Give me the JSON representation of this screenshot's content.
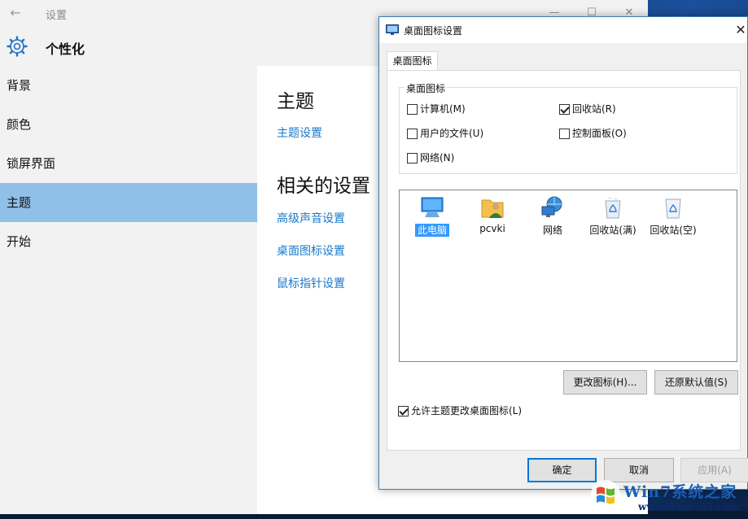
{
  "settings": {
    "window_title": "设置",
    "section_title": "个性化",
    "nav_items": [
      {
        "label": "背景"
      },
      {
        "label": "颜色"
      },
      {
        "label": "锁屏界面"
      },
      {
        "label": "主题",
        "active": true
      },
      {
        "label": "开始"
      }
    ],
    "content": {
      "heading": "主题",
      "theme_settings_link": "主题设置",
      "related_heading": "相关的设置",
      "related_links": [
        "高级声音设置",
        "桌面图标设置",
        "鼠标指针设置"
      ]
    }
  },
  "dialog": {
    "title": "桌面图标设置",
    "close_glyph": "✕",
    "tab_label": "桌面图标",
    "group_label": "桌面图标",
    "checkboxes": [
      {
        "label": "计算机(M)",
        "checked": false
      },
      {
        "label": "回收站(R)",
        "checked": true
      },
      {
        "label": "用户的文件(U)",
        "checked": false
      },
      {
        "label": "控制面板(O)",
        "checked": false
      },
      {
        "label": "网络(N)",
        "checked": false
      }
    ],
    "icons": [
      {
        "label": "此电脑",
        "icon": "computer-icon",
        "selected": true
      },
      {
        "label": "pcvki",
        "icon": "user-folder-icon",
        "selected": false
      },
      {
        "label": "网络",
        "icon": "network-icon",
        "selected": false
      },
      {
        "label": "回收站(满)",
        "icon": "recycle-bin-full-icon",
        "selected": false
      },
      {
        "label": "回收站(空)",
        "icon": "recycle-bin-empty-icon",
        "selected": false
      }
    ],
    "change_icon_button": "更改图标(H)...",
    "restore_default_button": "还原默认值(S)",
    "allow_themes_checkbox": {
      "label": "允许主题更改桌面图标(L)",
      "checked": true
    },
    "ok_button": "确定",
    "cancel_button": "取消",
    "apply_button": "应用(A)"
  },
  "watermark": {
    "text": "Win7系统之家",
    "url": "www.Winwin7.com"
  },
  "colors": {
    "accent_link": "#1979ca",
    "nav_active": "#90bfe8",
    "selection": "#3399ff"
  }
}
